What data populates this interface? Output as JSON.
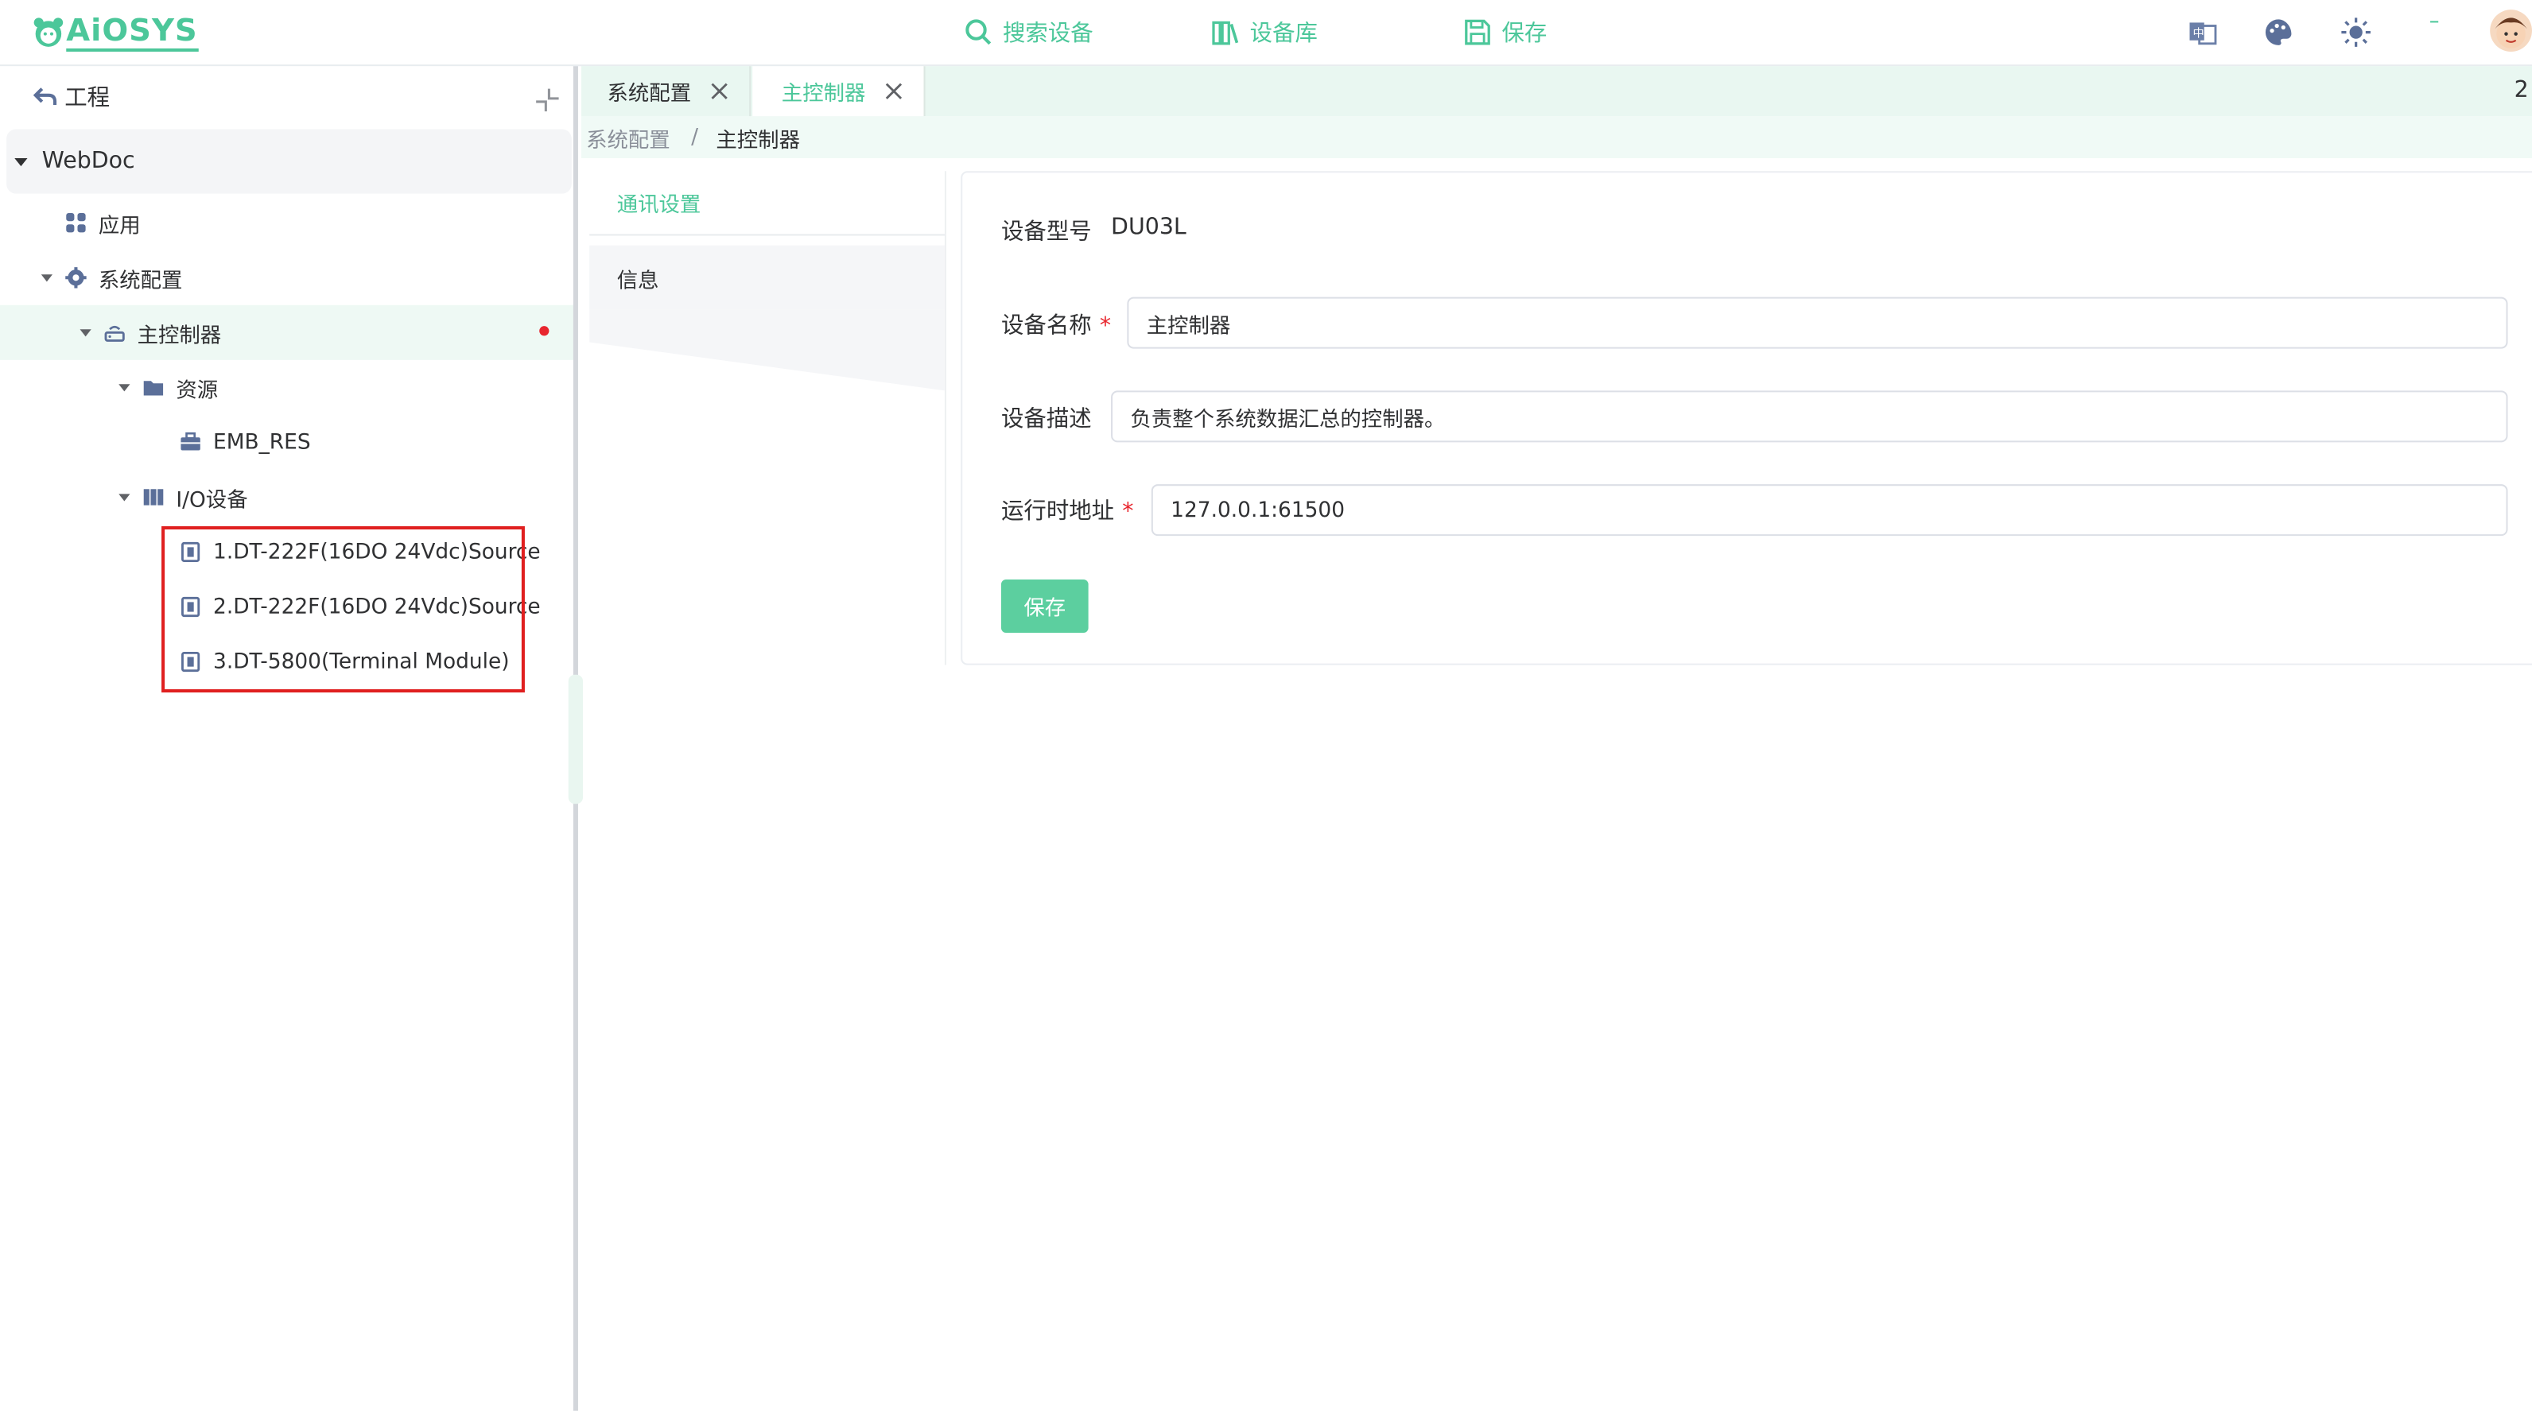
{
  "header": {
    "logo_text": "AiOSYS",
    "nav": [
      {
        "label": "搜索设备",
        "icon": "search-icon"
      },
      {
        "label": "设备库",
        "icon": "library-icon"
      },
      {
        "label": "保存",
        "icon": "save-icon"
      }
    ],
    "right_icons": [
      "translate-icon",
      "palette-icon",
      "sun-icon",
      "avatar"
    ],
    "accent_color": "#4cc79a"
  },
  "sidebar": {
    "header_title": "工程",
    "tree": {
      "root": "WebDoc",
      "app": "应用",
      "system_config": "系统配置",
      "main_controller": "主控制器",
      "resources": "资源",
      "emb_res": "EMB_RES",
      "io_devices": "I/O设备",
      "io_items": [
        "1.DT-222F(16DO 24Vdc)Source",
        "2.DT-222F(16DO 24Vdc)Source",
        "3.DT-5800(Terminal Module)"
      ]
    },
    "unsaved_indicator_color": "#e8262e"
  },
  "tabs": {
    "items": [
      {
        "label": "系统配置",
        "active": false
      },
      {
        "label": "主控制器",
        "active": true
      }
    ],
    "count": "2"
  },
  "breadcrumb": {
    "parent": "系统配置",
    "separator": "/",
    "current": "主控制器"
  },
  "settings_menu": {
    "items": [
      "通讯设置",
      "信息"
    ],
    "active": "通讯设置"
  },
  "form": {
    "model_label": "设备型号",
    "model_value": "DU03L",
    "name_label": "设备名称",
    "name_value": "主控制器",
    "desc_label": "设备描述",
    "desc_value": "负责整个系统数据汇总的控制器。",
    "addr_label": "运行时地址",
    "addr_value": "127.0.0.1:61500",
    "required_mark": "*",
    "save_label": "保存"
  }
}
